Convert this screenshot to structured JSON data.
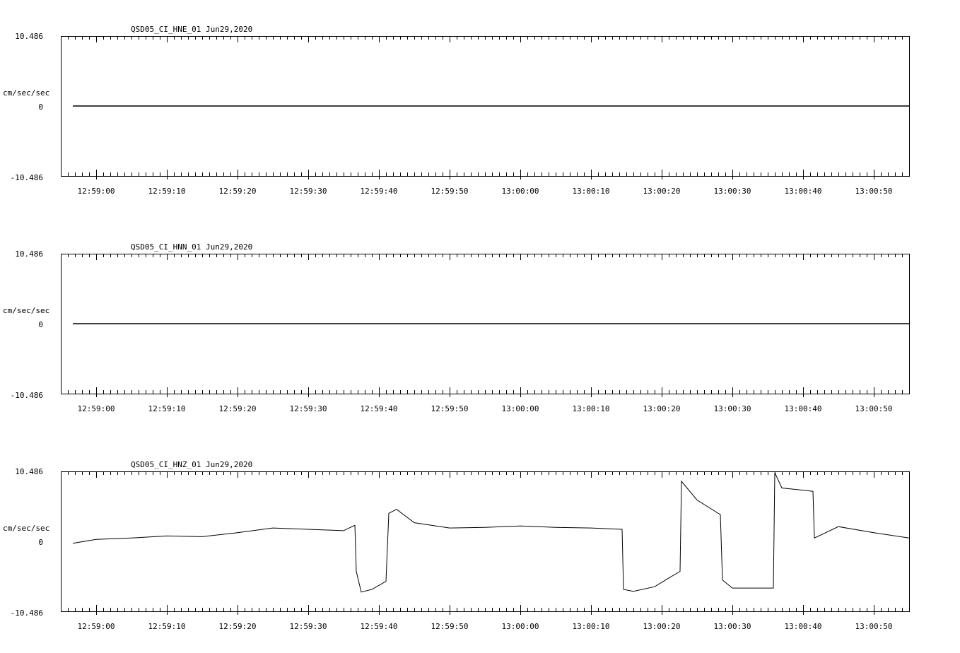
{
  "chart_data": [
    {
      "type": "line",
      "title": "QSD05_CI_HNE_01  Jun29,2020",
      "ylabel": "cm/sec/sec",
      "ylim": [
        -10.486,
        10.486
      ],
      "yticks": [
        "10.486",
        "0",
        "-10.486"
      ],
      "xlim": [
        "12:58:55",
        "13:00:55"
      ],
      "xticks": [
        "12:59:00",
        "12:59:10",
        "12:59:20",
        "12:59:30",
        "12:59:40",
        "12:59:50",
        "13:00:00",
        "13:00:10",
        "13:00:20",
        "13:00:30",
        "13:00:40",
        "13:00:50"
      ],
      "series": [
        {
          "x": [
            "12:58:56.7",
            "13:00:55"
          ],
          "y": [
            0,
            0
          ]
        }
      ]
    },
    {
      "type": "line",
      "title": "QSD05_CI_HNN_01  Jun29,2020",
      "ylabel": "cm/sec/sec",
      "ylim": [
        -10.486,
        10.486
      ],
      "yticks": [
        "10.486",
        "0",
        "-10.486"
      ],
      "xlim": [
        "12:58:55",
        "13:00:55"
      ],
      "xticks": [
        "12:59:00",
        "12:59:10",
        "12:59:20",
        "12:59:30",
        "12:59:40",
        "12:59:50",
        "13:00:00",
        "13:00:10",
        "13:00:20",
        "13:00:30",
        "13:00:40",
        "13:00:50"
      ],
      "series": [
        {
          "x": [
            "12:58:56.7",
            "13:00:55"
          ],
          "y": [
            0,
            0
          ]
        }
      ]
    },
    {
      "type": "line",
      "title": "QSD05_CI_HNZ_01  Jun29,2020",
      "ylabel": "cm/sec/sec",
      "ylim": [
        -10.486,
        10.486
      ],
      "yticks": [
        "10.486",
        "0",
        "-10.486"
      ],
      "xlim": [
        "12:58:55",
        "13:00:55"
      ],
      "xticks": [
        "12:59:00",
        "12:59:10",
        "12:59:20",
        "12:59:30",
        "12:59:40",
        "12:59:50",
        "13:00:00",
        "13:00:10",
        "13:00:20",
        "13:00:30",
        "13:00:40",
        "13:00:50"
      ],
      "series": [
        {
          "x": [
            "12:58:56.7",
            "12:59:00",
            "12:59:05",
            "12:59:10",
            "12:59:15",
            "12:59:20",
            "12:59:25",
            "12:59:30",
            "12:59:35",
            "12:59:36.6",
            "12:59:36.8",
            "12:59:37.5",
            "12:59:39",
            "12:59:41",
            "12:59:41.4",
            "12:59:42.5",
            "12:59:45",
            "12:59:50",
            "12:59:55",
            "13:00:00",
            "13:00:05",
            "13:00:10",
            "13:00:14.4",
            "13:00:14.6",
            "13:00:16",
            "13:00:19",
            "13:00:21",
            "13:00:22.6",
            "13:00:22.8",
            "13:00:25",
            "13:00:28.3",
            "13:00:28.6",
            "13:00:30",
            "13:00:35.8",
            "13:00:36",
            "13:00:37",
            "13:00:41.4",
            "13:00:41.6",
            "13:00:45",
            "13:00:50",
            "13:00:55"
          ],
          "y": [
            -0.3,
            0.3,
            0.5,
            0.8,
            0.7,
            1.3,
            2.0,
            1.8,
            1.6,
            2.4,
            -4.5,
            -7.6,
            -7.2,
            -6.0,
            4.2,
            4.8,
            2.8,
            2.0,
            2.1,
            2.3,
            2.1,
            2.0,
            1.8,
            -7.2,
            -7.5,
            -6.8,
            -5.5,
            -4.5,
            9.0,
            6.2,
            4.0,
            -5.8,
            -7.0,
            -7.0,
            10.3,
            8.0,
            7.5,
            0.5,
            2.2,
            1.3,
            0.5
          ]
        }
      ]
    }
  ]
}
